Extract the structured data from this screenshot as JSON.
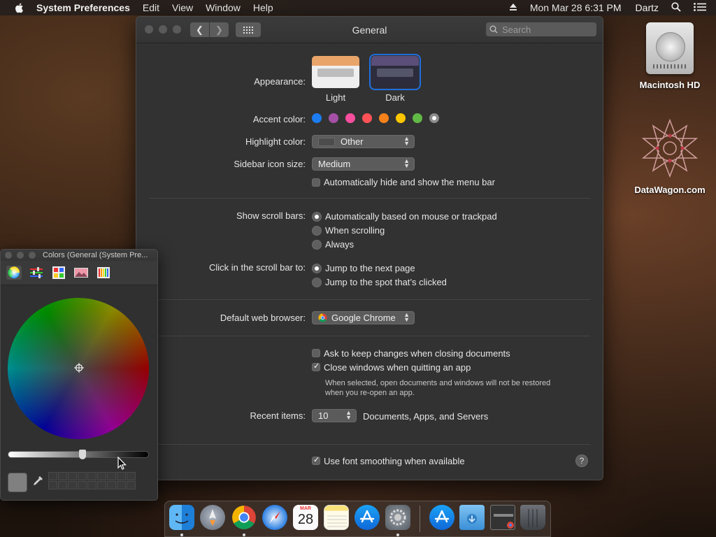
{
  "menubar": {
    "app": "System Preferences",
    "items": [
      "Edit",
      "View",
      "Window",
      "Help"
    ],
    "clock": "Mon Mar 28  6:31 PM",
    "user": "Dartz"
  },
  "desktop": {
    "icons": [
      {
        "label": "Macintosh HD"
      },
      {
        "label": "DataWagon.com"
      }
    ]
  },
  "window": {
    "title": "General",
    "search_placeholder": "Search",
    "appearance": {
      "label": "Appearance:",
      "options": [
        {
          "label": "Light"
        },
        {
          "label": "Dark"
        }
      ],
      "selected": "Dark"
    },
    "accent": {
      "label": "Accent color:",
      "colors": [
        "#1c7cf2",
        "#a550a7",
        "#f74f9e",
        "#ff5257",
        "#f7821b",
        "#ffc600",
        "#62ba46",
        "#8c8c8c"
      ],
      "selected_index": 7
    },
    "highlight": {
      "label": "Highlight color:",
      "value": "Other"
    },
    "sidebar_size": {
      "label": "Sidebar icon size:",
      "value": "Medium"
    },
    "autohide_menubar": {
      "label": "Automatically hide and show the menu bar",
      "checked": false
    },
    "scrollbars": {
      "label": "Show scroll bars:",
      "options": [
        "Automatically based on mouse or trackpad",
        "When scrolling",
        "Always"
      ],
      "selected_index": 0
    },
    "scroll_click": {
      "label": "Click in the scroll bar to:",
      "options": [
        "Jump to the next page",
        "Jump to the spot that’s clicked"
      ],
      "selected_index": 0
    },
    "browser": {
      "label": "Default web browser:",
      "value": "Google Chrome"
    },
    "ask_keep": {
      "label": "Ask to keep changes when closing documents",
      "checked": false
    },
    "close_windows": {
      "label": "Close windows when quitting an app",
      "checked": true,
      "note1": "When selected, open documents and windows will not be restored",
      "note2": "when you re-open an app."
    },
    "recent": {
      "label": "Recent items:",
      "value": "10",
      "suffix": "Documents, Apps, and Servers"
    },
    "font_smoothing": {
      "label": "Use font smoothing when available",
      "checked": true
    },
    "help": "?"
  },
  "colors_panel": {
    "title": "Colors (General (System Pre...",
    "brightness": 0.53,
    "current_color": "#808080"
  },
  "dock": {
    "items": [
      "finder-icon",
      "launchpad-icon",
      "chrome-icon",
      "safari-icon",
      "calendar-icon",
      "notes-icon",
      "app-store-icon",
      "system-preferences-icon",
      "downloads-app-store-icon",
      "downloads-folder-icon",
      "screenshot-thumbnail-icon",
      "trash-icon"
    ],
    "calendar_month": "MAR",
    "calendar_day": "28"
  }
}
